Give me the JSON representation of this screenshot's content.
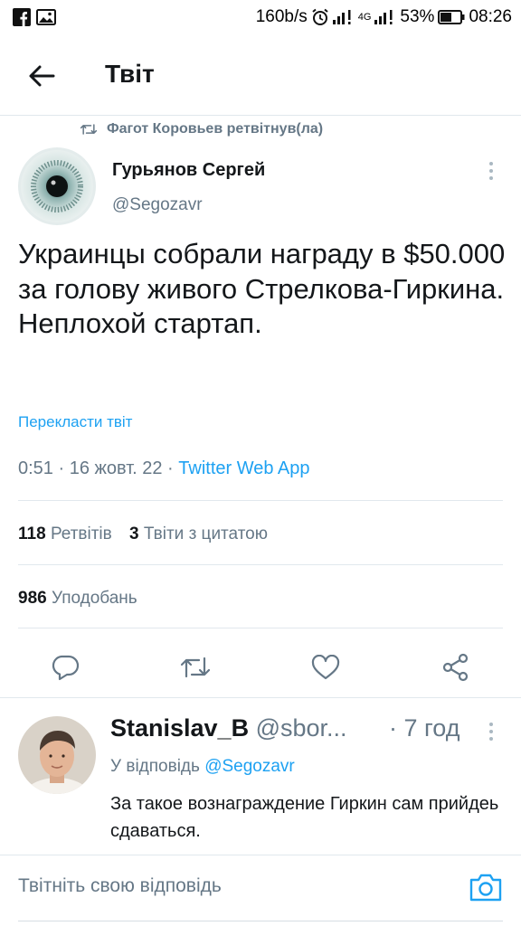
{
  "status_bar": {
    "speed": "160b/s",
    "network": "4G",
    "battery": "53%",
    "time": "08:26"
  },
  "header": {
    "title": "Твіт"
  },
  "retweet_context": {
    "text": "Фагот Коровьев ретвітнув(ла)"
  },
  "tweet": {
    "author_name": "Гурьянов Сергей",
    "author_handle": "@Segozavr",
    "text": "Украинцы собрали награду в $50.000 за голову живого Стрелкова-Гиркина. Неплохой стартап.",
    "translate_label": "Перекласти твіт",
    "timestamp": "0:51 · 16 жовт. 22 · ",
    "source": "Twitter Web App",
    "retweets_count": "118",
    "retweets_label": "Ретвітів",
    "quotes_count": "3",
    "quotes_label": "Твіти з цитатою",
    "likes_count": "986",
    "likes_label": "Уподобань"
  },
  "actions": [
    "reply-icon",
    "retweet-icon",
    "like-icon",
    "share-icon"
  ],
  "reply": {
    "author_name": "Stanislav_B",
    "author_handle": "@sbor...",
    "time": "· 7 год",
    "reply_to_label": "У відповідь",
    "reply_to_handle": "@Segozavr",
    "text": "За такое вознаграждение Гиркин сам прийдеь сдаваться."
  },
  "composer": {
    "placeholder": "Твітніть свою відповідь"
  },
  "colors": {
    "accent": "#1da1f2",
    "secondary_text": "#657786",
    "primary_text": "#14171a",
    "divider": "#e1e8ed"
  }
}
